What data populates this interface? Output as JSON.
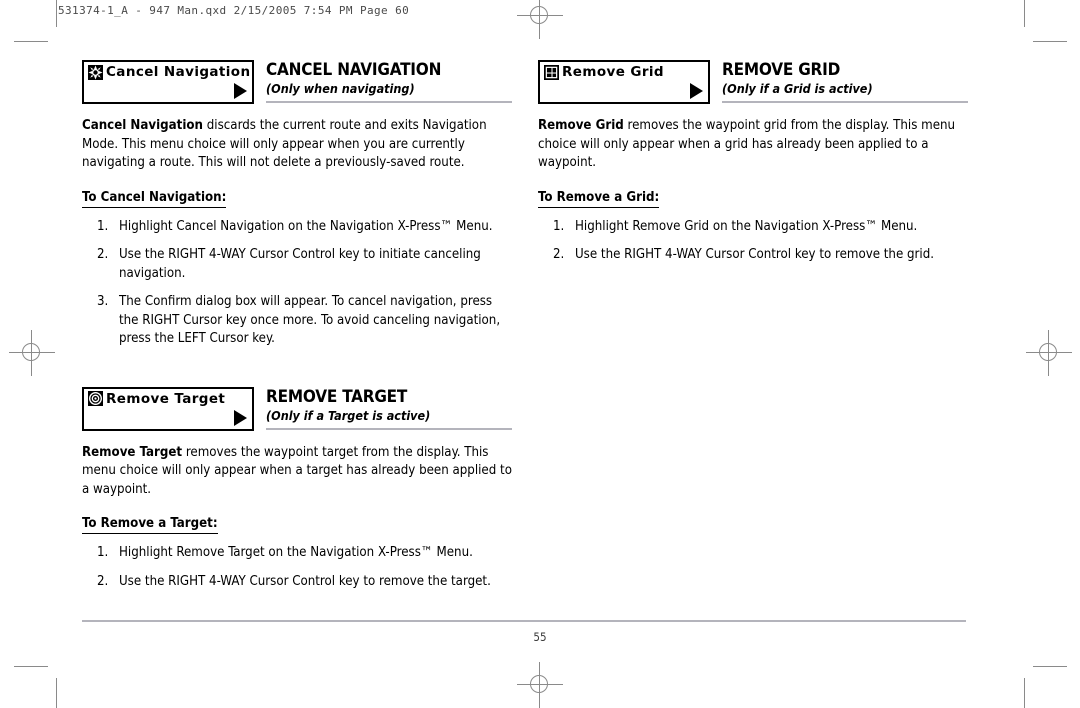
{
  "slug": "531374-1_A - 947 Man.qxd   2/15/2005   7:54 PM   Page 60",
  "footer": {
    "page_number": "55"
  },
  "sections": [
    {
      "id": "cancel-navigation",
      "column": "left",
      "chip": {
        "label": "Cancel Navigation",
        "icon": "compass-rose-icon",
        "arrow": "right-arrow-icon"
      },
      "title": "CANCEL NAVIGATION",
      "subtitle": "(Only when navigating)",
      "body_lead": "Cancel Navigation",
      "body_rest": " discards the current route and exits Navigation Mode. This menu choice will only appear when you are currently navigating a route. This will not delete a previously-saved route.",
      "procedure_title": "To Cancel Navigation:",
      "steps": [
        {
          "num": "1.",
          "text": "Highlight Cancel Navigation on the Navigation X-Press™ Menu."
        },
        {
          "num": "2.",
          "text": "Use the RIGHT 4-WAY Cursor Control key to initiate canceling navigation."
        },
        {
          "num": "3.",
          "text": "The Confirm dialog box will appear. To cancel navigation, press the RIGHT Cursor key once more. To avoid canceling navigation, press the LEFT Cursor key."
        }
      ]
    },
    {
      "id": "remove-target",
      "column": "left",
      "chip": {
        "label": "Remove Target",
        "icon": "target-icon",
        "arrow": "right-arrow-icon"
      },
      "title": "REMOVE TARGET",
      "subtitle": "(Only if a Target is active)",
      "body_lead": "Remove Target",
      "body_rest": " removes the waypoint target from the display. This menu choice will only appear when a target has already been applied to a waypoint.",
      "procedure_title": "To Remove a Target:",
      "steps": [
        {
          "num": "1.",
          "text": "Highlight Remove Target on the Navigation X-Press™ Menu."
        },
        {
          "num": "2.",
          "text": "Use the RIGHT 4-WAY Cursor Control key to remove the target."
        }
      ]
    },
    {
      "id": "remove-grid",
      "column": "right",
      "chip": {
        "label": "Remove Grid",
        "icon": "grid-icon",
        "arrow": "right-arrow-icon"
      },
      "title": "REMOVE GRID",
      "subtitle": "(Only if a Grid is active)",
      "body_lead": "Remove Grid",
      "body_rest": " removes the waypoint grid from the display. This menu choice will only appear when a grid has already been applied to a waypoint.",
      "procedure_title": "To Remove a Grid:",
      "steps": [
        {
          "num": "1.",
          "text": "Highlight Remove Grid on the Navigation X-Press™ Menu."
        },
        {
          "num": "2.",
          "text": "Use the RIGHT 4-WAY Cursor Control key to remove the grid."
        }
      ]
    }
  ],
  "colors": {
    "rule": "#b4b4bc",
    "mark": "#8a8a8a",
    "text": "#000000"
  }
}
